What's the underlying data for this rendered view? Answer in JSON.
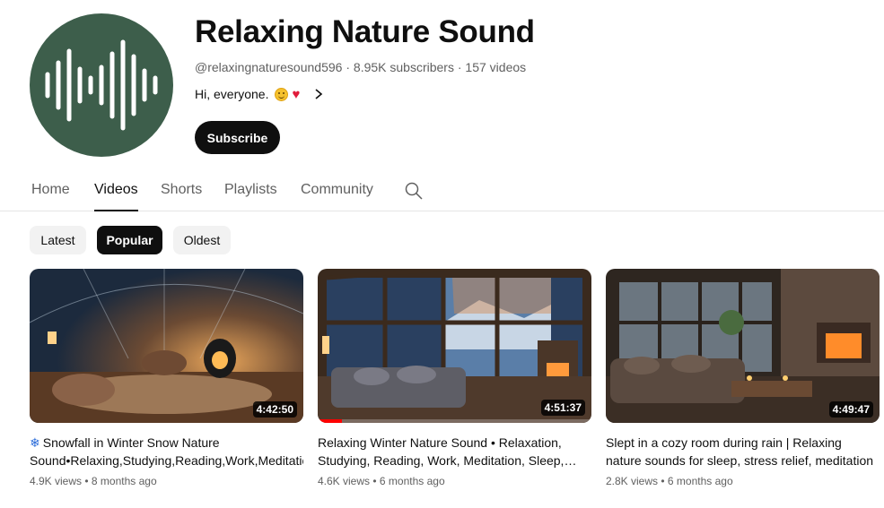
{
  "channel": {
    "name": "Relaxing Nature Sound",
    "handle": "@relaxingnaturesound596",
    "subscribers": "8.95K subscribers",
    "videos": "157 videos",
    "meta_separator": " · ",
    "description": "Hi, everyone.",
    "subscribe_label": "Subscribe",
    "avatar_color": "#3d5e4b"
  },
  "tabs": [
    {
      "label": "Home",
      "active": false
    },
    {
      "label": "Videos",
      "active": true
    },
    {
      "label": "Shorts",
      "active": false
    },
    {
      "label": "Playlists",
      "active": false
    },
    {
      "label": "Community",
      "active": false
    }
  ],
  "chips": [
    {
      "label": "Latest",
      "active": false
    },
    {
      "label": "Popular",
      "active": true
    },
    {
      "label": "Oldest",
      "active": false
    }
  ],
  "videos": [
    {
      "title": "Snowfall in Winter Snow Nature Sound•Relaxing,Studying,Reading,Work,Meditation",
      "title_prefix_icon": "snowflake-icon",
      "duration": "4:42:50",
      "views": "4.9K views",
      "age": "8 months ago",
      "watched_fraction": 0
    },
    {
      "title": "Relaxing Winter Nature Sound • Relaxation, Studying, Reading, Work, Meditation, Sleep, Calm",
      "duration": "4:51:37",
      "views": "4.6K views",
      "age": "6 months ago",
      "watched_fraction": 0.09
    },
    {
      "title": "Slept in a cozy room during rain | Relaxing nature sounds for sleep, stress relief, meditation",
      "duration": "4:49:47",
      "views": "2.8K views",
      "age": "6 months ago",
      "watched_fraction": 0
    }
  ],
  "colors": {
    "accent": "#0f0f0f",
    "secondary_text": "#606060",
    "progress": "#ff0000"
  }
}
